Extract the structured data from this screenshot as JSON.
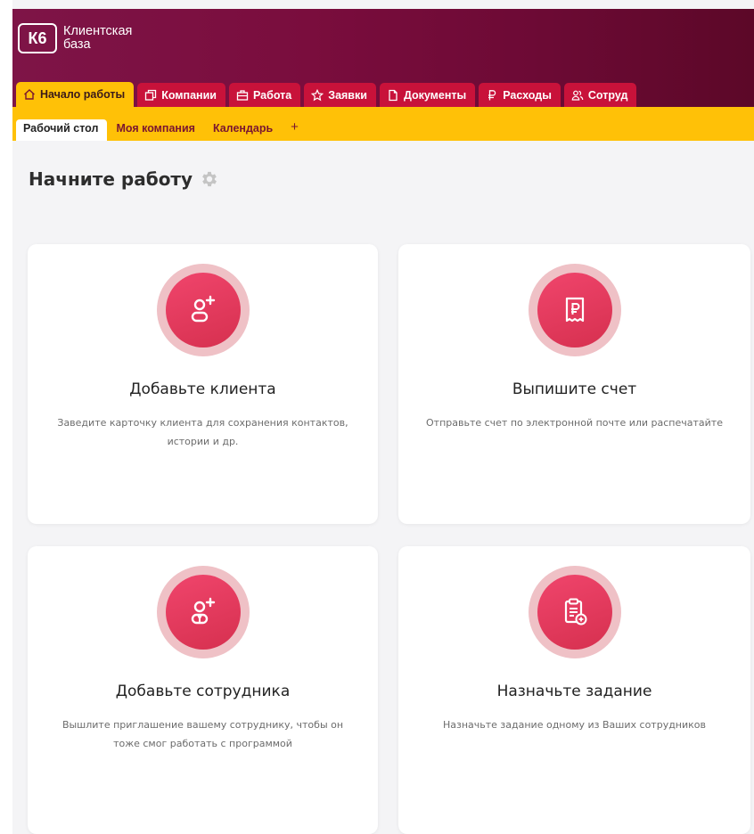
{
  "app": {
    "logo_badge": "К6",
    "logo_line1": "Клиентская",
    "logo_line2": "база"
  },
  "tabs": [
    {
      "label": "Начало работы",
      "icon": "home-icon",
      "active": true
    },
    {
      "label": "Компании",
      "icon": "windows-icon",
      "active": false
    },
    {
      "label": "Работа",
      "icon": "briefcase-icon",
      "active": false
    },
    {
      "label": "Заявки",
      "icon": "star-icon",
      "active": false
    },
    {
      "label": "Документы",
      "icon": "document-icon",
      "active": false
    },
    {
      "label": "Расходы",
      "icon": "ruble-icon",
      "active": false
    },
    {
      "label": "Сотруд",
      "icon": "users-icon",
      "active": false
    }
  ],
  "subtabs": [
    {
      "label": "Рабочий стол",
      "active": true
    },
    {
      "label": "Моя компания",
      "active": false
    },
    {
      "label": "Календарь",
      "active": false
    },
    {
      "label": "+",
      "active": false
    }
  ],
  "page": {
    "title": "Начните работу",
    "title_icon": "gear-icon"
  },
  "cards": [
    {
      "title": "Добавьте клиента",
      "desc_line1": "Заведите карточку клиента для сохранения контактов,",
      "desc_line2": "истории и др.",
      "icon": "add-user-icon"
    },
    {
      "title": "Выпишите счет",
      "desc_line1": "Отправьте счет по электронной почте или распечатайте",
      "desc_line2": "",
      "icon": "receipt-ruble-icon"
    },
    {
      "title": "Добавьте сотрудника",
      "desc_line1": "Вышлите приглашение вашему сотруднику, чтобы он",
      "desc_line2": "тоже смог работать с программой",
      "icon": "add-employee-icon"
    },
    {
      "title": "Назначьте задание",
      "desc_line1": "Назначьте задание одному из Ваших сотрудников",
      "desc_line2": "",
      "icon": "clipboard-task-icon"
    }
  ],
  "colors": {
    "header_bg": "#7a0d3d",
    "tab_bg": "#c8123a",
    "accent_yellow": "#ffc107",
    "icon_circle": "#e03a5c",
    "icon_halo": "#efc1c6"
  }
}
